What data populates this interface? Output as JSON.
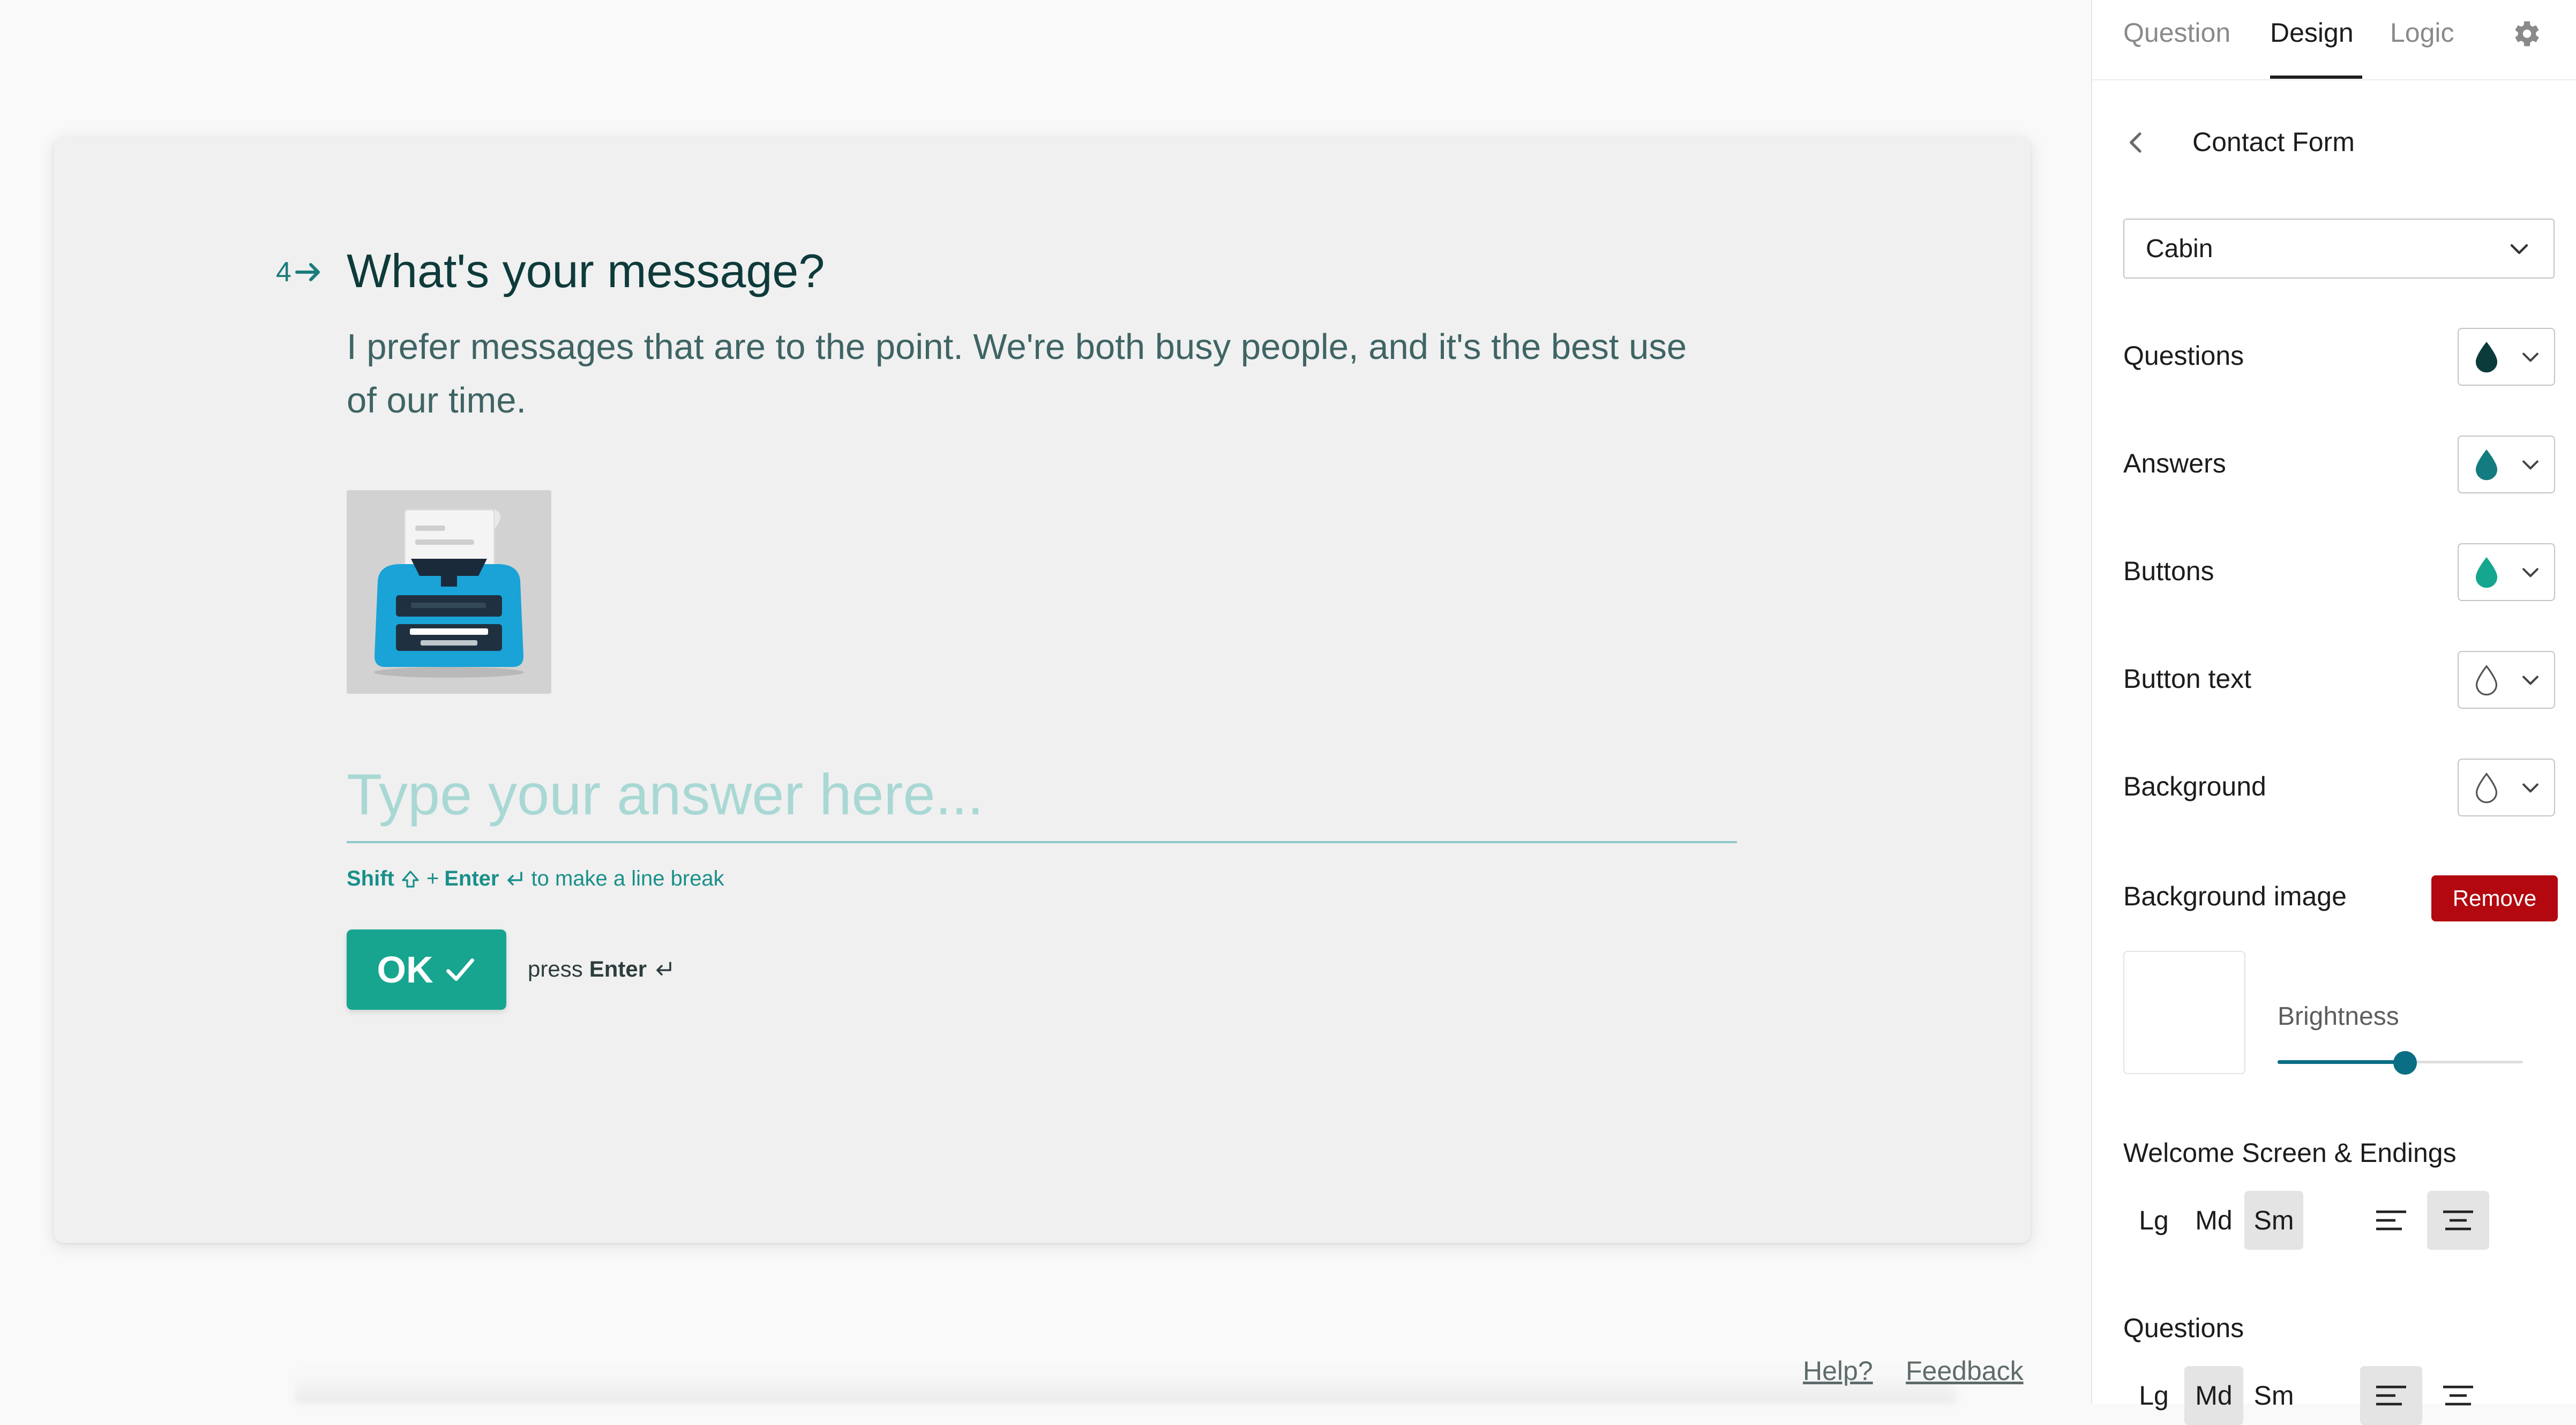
{
  "question": {
    "number": "4",
    "title": "What's your message?",
    "description": "I prefer messages that are to the point. We're both busy people, and it's the best use of our time.",
    "answer_placeholder": "Type your answer here...",
    "hint_shift": "Shift",
    "hint_plus": "+",
    "hint_enter": "Enter",
    "hint_text": "to make a line break",
    "ok_label": "OK",
    "press_text": "press",
    "press_enter": "Enter"
  },
  "footer": {
    "help": "Help?",
    "feedback": "Feedback"
  },
  "panel": {
    "tabs": [
      {
        "label": "Question",
        "active": false
      },
      {
        "label": "Design",
        "active": true
      },
      {
        "label": "Logic",
        "active": false
      }
    ],
    "form_title": "Contact Form",
    "font": "Cabin",
    "colors": [
      {
        "label": "Questions",
        "color": "#0b3b3b",
        "filled": true
      },
      {
        "label": "Answers",
        "color": "#137c80",
        "filled": true
      },
      {
        "label": "Buttons",
        "color": "#15a68f",
        "filled": true
      },
      {
        "label": "Button text",
        "color": "#ffffff",
        "filled": false
      },
      {
        "label": "Background",
        "color": "#ffffff",
        "filled": false
      }
    ],
    "background_image_label": "Background image",
    "remove_label": "Remove",
    "brightness_label": "Brightness",
    "brightness_value": 0.52,
    "welcome_label": "Welcome Screen & Endings",
    "welcome_sizes": [
      {
        "label": "Lg",
        "active": false
      },
      {
        "label": "Md",
        "active": false
      },
      {
        "label": "Sm",
        "active": true
      }
    ],
    "welcome_align": [
      "left",
      "center"
    ],
    "welcome_align_active": "center",
    "questions_label": "Questions",
    "question_sizes": [
      {
        "label": "Lg",
        "active": false
      },
      {
        "label": "Md",
        "active": true
      },
      {
        "label": "Sm",
        "active": false
      }
    ],
    "question_align": [
      "left",
      "center"
    ],
    "question_align_active": "left"
  },
  "icons": {
    "settings": "gear-icon",
    "back": "chevron-left-icon",
    "dropdown": "chevron-down-icon",
    "color": "droplet-icon",
    "image": "typewriter-illustration"
  }
}
